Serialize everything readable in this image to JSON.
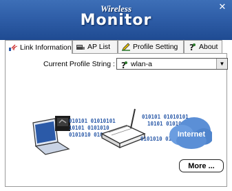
{
  "window": {
    "title_small": "Wireless",
    "title_big": "Monitor",
    "close_glyph": "✕"
  },
  "tabs": [
    {
      "label": "Link Information",
      "icon": "signal-icon",
      "active": true
    },
    {
      "label": "AP List",
      "icon": "ap-list-icon",
      "active": false
    },
    {
      "label": "Profile Setting",
      "icon": "pencil-icon",
      "active": false
    },
    {
      "label": "About",
      "icon": "question-icon",
      "active": false
    }
  ],
  "profile": {
    "label": "Current Profile String :",
    "value": "wlan-a",
    "value_icon": "question-icon"
  },
  "illustration": {
    "internet_label": "Internet",
    "bits_row1": "010101 01010101",
    "bits_row2": "10101 0101010",
    "bits_row3": "0101010 010101010"
  },
  "buttons": {
    "more": "More ..."
  },
  "colors": {
    "titlebar": "#2f5ea8",
    "cloud": "#5b8fd6"
  }
}
